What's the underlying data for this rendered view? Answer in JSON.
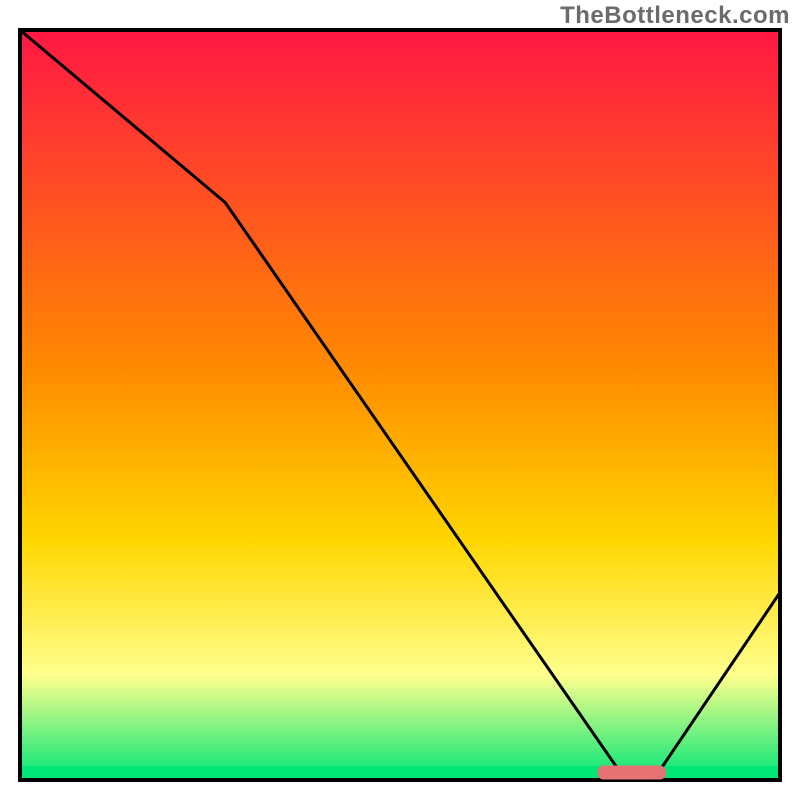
{
  "watermark": "TheBottleneck.com",
  "chart_data": {
    "type": "line",
    "title": "",
    "xlabel": "",
    "ylabel": "",
    "xlim": [
      0,
      100
    ],
    "ylim": [
      0,
      100
    ],
    "x": [
      0,
      27,
      79,
      81,
      84,
      100
    ],
    "values": [
      100,
      77,
      1,
      1,
      1,
      25
    ],
    "optimal_marker": {
      "x_start": 76,
      "x_end": 85,
      "y": 1,
      "color": "#e57373"
    },
    "background_gradient": {
      "top": "#ff1744",
      "mid1": "#ff8a00",
      "mid2": "#ffd600",
      "mid3": "#ffff8d",
      "bottom": "#00e676"
    },
    "plot_border": "#000000"
  }
}
